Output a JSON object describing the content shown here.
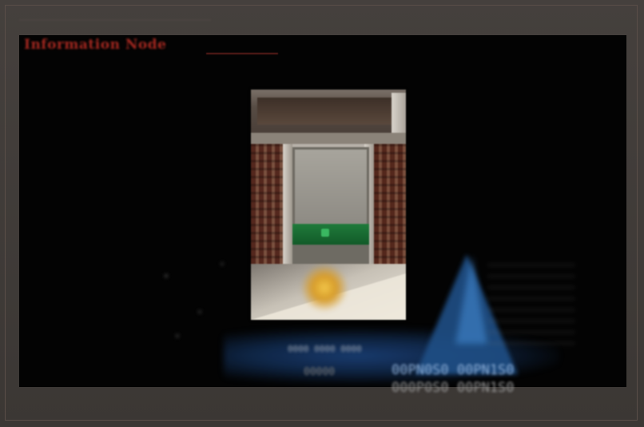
{
  "window": {
    "title": "Information Node"
  },
  "scene": {
    "readout_row_1": "00PN0S0 00PN1S0",
    "readout_row_2": "000P0S0 00PN1S0",
    "small_text_1": "0000 0000 0000",
    "small_text_2": "00000"
  },
  "colors": {
    "title": "#a42820",
    "frame": "#3b3734",
    "screen": "#030303",
    "accent_blue": "#1f4f86",
    "door_green": "#1f7a3a"
  }
}
